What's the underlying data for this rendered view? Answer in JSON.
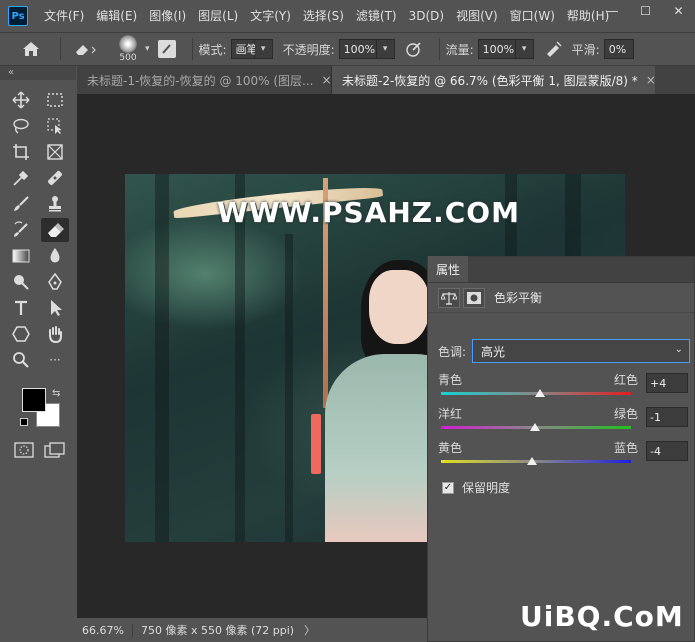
{
  "app": {
    "logo": "Ps",
    "menu": [
      "文件(F)",
      "编辑(E)",
      "图像(I)",
      "图层(L)",
      "文字(Y)",
      "选择(S)",
      "滤镜(T)",
      "3D(D)",
      "视图(V)",
      "窗口(W)",
      "帮助(H)"
    ],
    "window_controls": [
      "—",
      "☐",
      "✕"
    ]
  },
  "options": {
    "brush_size": "500",
    "mode_label": "模式:",
    "mode_value": "画笔",
    "opacity_label": "不透明度:",
    "opacity_value": "100%",
    "flow_label": "流量:",
    "flow_value": "100%",
    "smooth_label": "平滑:",
    "smooth_value": "0%"
  },
  "tabs": [
    {
      "label": "未标题-1-恢复的-恢复的 @ 100% (图层...",
      "close": "×"
    },
    {
      "label": "未标题-2-恢复的 @ 66.7% (色彩平衡 1, 图层蒙版/8) *",
      "close": "×"
    }
  ],
  "canvas": {
    "watermark": "WWW.PSAHZ.COM"
  },
  "status": {
    "zoom": "66.67%",
    "info": "750 像素 x 550 像素 (72 ppi)",
    "arrow": "〉"
  },
  "properties": {
    "tab": "属性",
    "title": "色彩平衡",
    "tone_label": "色调:",
    "tone_value": "高光",
    "sliders": [
      {
        "left": "青色",
        "right": "红色",
        "value": "+4",
        "numeric": 4
      },
      {
        "left": "洋红",
        "right": "绿色",
        "value": "-1",
        "numeric": -1
      },
      {
        "left": "黄色",
        "right": "蓝色",
        "value": "-4",
        "numeric": -4
      }
    ],
    "preserve_label": "保留明度",
    "preserve_checked": true
  },
  "footer_watermark": "UiBQ.CoM"
}
